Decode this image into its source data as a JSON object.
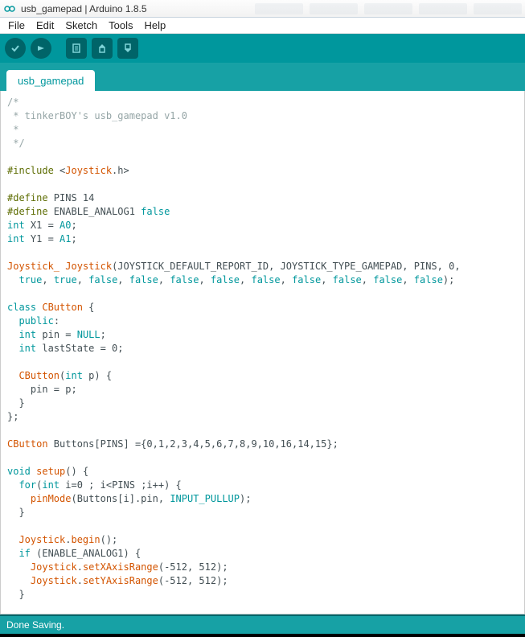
{
  "window": {
    "title": "usb_gamepad | Arduino 1.8.5"
  },
  "menu": {
    "file": "File",
    "edit": "Edit",
    "sketch": "Sketch",
    "tools": "Tools",
    "help": "Help"
  },
  "tab": {
    "name": "usb_gamepad"
  },
  "status": {
    "text": "Done Saving."
  },
  "code": "/*\n * tinkerBOY's usb_gamepad v1.0\n * \n */\n\n#include <Joystick.h>\n\n#define PINS 14\n#define ENABLE_ANALOG1 false\nint X1 = A0;\nint Y1 = A1;\n\nJoystick_ Joystick(JOYSTICK_DEFAULT_REPORT_ID, JOYSTICK_TYPE_GAMEPAD, PINS, 0,\n  true, true, false, false, false, false, false, false, false, false, false);\n\nclass CButton {\n  public:\n  int pin = NULL;\n  int lastState = 0;\n\n  CButton(int p) {\n    pin = p;\n  }\n};\n\nCButton Buttons[PINS] ={0,1,2,3,4,5,6,7,8,9,10,16,14,15};\n\nvoid setup() {\n  for(int i=0 ; i<PINS ;i++) {\n    pinMode(Buttons[i].pin, INPUT_PULLUP);\n  }\n\n  Joystick.begin();\n  if (ENABLE_ANALOG1) {\n    Joystick.setXAxisRange(-512, 512);\n    Joystick.setYAxisRange(-512, 512);\n  }"
}
